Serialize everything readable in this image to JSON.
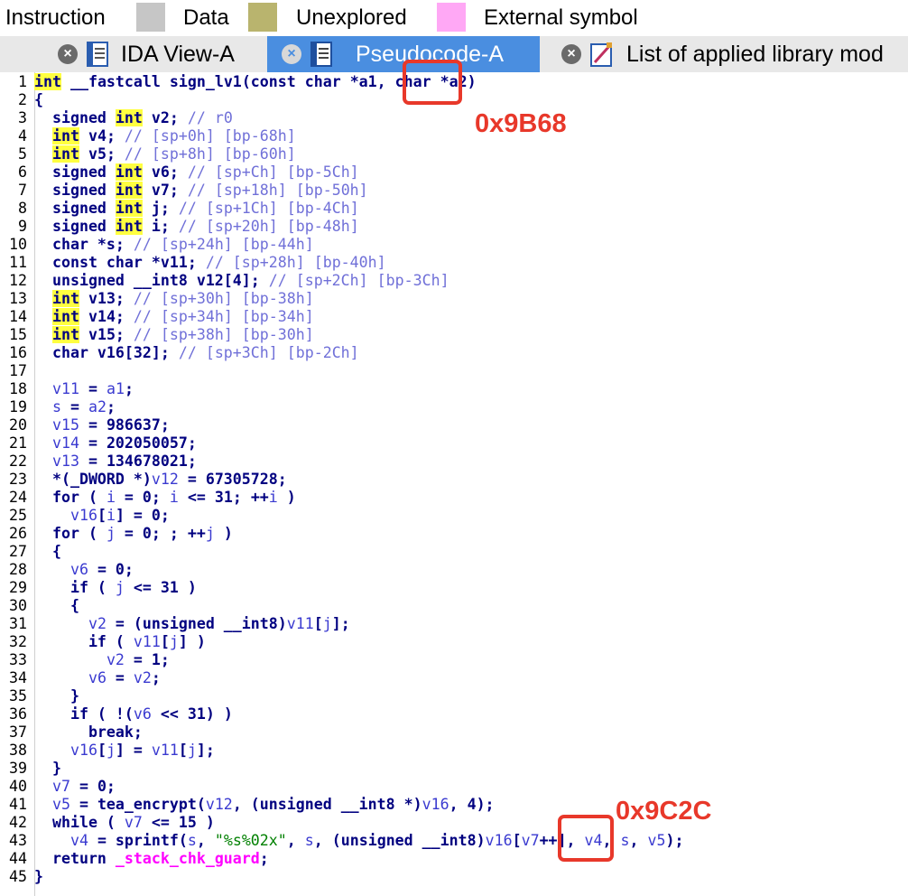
{
  "legend": {
    "items": [
      {
        "label": "Instruction",
        "color": "#c6c6c6"
      },
      {
        "label": "Data",
        "color": "#b9b46e"
      },
      {
        "label": "Unexplored",
        "color": "#ffa8f5"
      },
      {
        "label": "External symbol",
        "color": ""
      }
    ]
  },
  "tabs": [
    {
      "label": "IDA View-A",
      "icon": "document-icon",
      "active": false
    },
    {
      "label": "Pseudocode-A",
      "icon": "pseudocode-icon",
      "active": true
    },
    {
      "label": "List of applied library mod",
      "icon": "library-icon",
      "active": false
    }
  ],
  "annotations": [
    {
      "label": "0x9B68"
    },
    {
      "label": "0x9C2C"
    }
  ],
  "code": {
    "lines": [
      {
        "n": "1",
        "t": [
          [
            "kh",
            "int"
          ],
          [
            "p",
            " __fastcall "
          ],
          [
            "p",
            "sign_lv1"
          ],
          [
            "p",
            "(const char *a1, char *a2)"
          ]
        ]
      },
      {
        "n": "2",
        "t": [
          [
            "p",
            "{"
          ]
        ]
      },
      {
        "n": "3",
        "t": [
          [
            "p",
            "  signed "
          ],
          [
            "kh",
            "int"
          ],
          [
            "p",
            " v2; "
          ],
          [
            "c",
            "// r0"
          ]
        ]
      },
      {
        "n": "4",
        "t": [
          [
            "p",
            "  "
          ],
          [
            "kh",
            "int"
          ],
          [
            "p",
            " v4; "
          ],
          [
            "c",
            "// [sp+0h] [bp-68h]"
          ]
        ]
      },
      {
        "n": "5",
        "t": [
          [
            "p",
            "  "
          ],
          [
            "kh",
            "int"
          ],
          [
            "p",
            " v5; "
          ],
          [
            "c",
            "// [sp+8h] [bp-60h]"
          ]
        ]
      },
      {
        "n": "6",
        "t": [
          [
            "p",
            "  signed "
          ],
          [
            "kh",
            "int"
          ],
          [
            "p",
            " v6; "
          ],
          [
            "c",
            "// [sp+Ch] [bp-5Ch]"
          ]
        ]
      },
      {
        "n": "7",
        "t": [
          [
            "p",
            "  signed "
          ],
          [
            "kh",
            "int"
          ],
          [
            "p",
            " v7; "
          ],
          [
            "c",
            "// [sp+18h] [bp-50h]"
          ]
        ]
      },
      {
        "n": "8",
        "t": [
          [
            "p",
            "  signed "
          ],
          [
            "kh",
            "int"
          ],
          [
            "p",
            " j; "
          ],
          [
            "c",
            "// [sp+1Ch] [bp-4Ch]"
          ]
        ]
      },
      {
        "n": "9",
        "t": [
          [
            "p",
            "  signed "
          ],
          [
            "kh",
            "int"
          ],
          [
            "p",
            " i; "
          ],
          [
            "c",
            "// [sp+20h] [bp-48h]"
          ]
        ]
      },
      {
        "n": "10",
        "t": [
          [
            "p",
            "  char *s; "
          ],
          [
            "c",
            "// [sp+24h] [bp-44h]"
          ]
        ]
      },
      {
        "n": "11",
        "t": [
          [
            "p",
            "  const char *v11; "
          ],
          [
            "c",
            "// [sp+28h] [bp-40h]"
          ]
        ]
      },
      {
        "n": "12",
        "t": [
          [
            "p",
            "  unsigned __int8 v12[4]; "
          ],
          [
            "c",
            "// [sp+2Ch] [bp-3Ch]"
          ]
        ]
      },
      {
        "n": "13",
        "t": [
          [
            "p",
            "  "
          ],
          [
            "kh",
            "int"
          ],
          [
            "p",
            " v13; "
          ],
          [
            "c",
            "// [sp+30h] [bp-38h]"
          ]
        ]
      },
      {
        "n": "14",
        "t": [
          [
            "p",
            "  "
          ],
          [
            "kh",
            "int"
          ],
          [
            "p",
            " v14; "
          ],
          [
            "c",
            "// [sp+34h] [bp-34h]"
          ]
        ]
      },
      {
        "n": "15",
        "t": [
          [
            "p",
            "  "
          ],
          [
            "kh",
            "int"
          ],
          [
            "p",
            " v15; "
          ],
          [
            "c",
            "// [sp+38h] [bp-30h]"
          ]
        ]
      },
      {
        "n": "16",
        "t": [
          [
            "p",
            "  char v16[32]; "
          ],
          [
            "c",
            "// [sp+3Ch] [bp-2Ch]"
          ]
        ]
      },
      {
        "n": "17",
        "t": []
      },
      {
        "n": "18",
        "t": [
          [
            "p",
            "  "
          ],
          [
            "v",
            "v11"
          ],
          [
            "p",
            " = "
          ],
          [
            "v",
            "a1"
          ],
          [
            "p",
            ";"
          ]
        ]
      },
      {
        "n": "19",
        "t": [
          [
            "p",
            "  "
          ],
          [
            "v",
            "s"
          ],
          [
            "p",
            " = "
          ],
          [
            "v",
            "a2"
          ],
          [
            "p",
            ";"
          ]
        ]
      },
      {
        "n": "20",
        "t": [
          [
            "p",
            "  "
          ],
          [
            "v",
            "v15"
          ],
          [
            "p",
            " = 986637;"
          ]
        ]
      },
      {
        "n": "21",
        "t": [
          [
            "p",
            "  "
          ],
          [
            "v",
            "v14"
          ],
          [
            "p",
            " = 202050057;"
          ]
        ]
      },
      {
        "n": "22",
        "t": [
          [
            "p",
            "  "
          ],
          [
            "v",
            "v13"
          ],
          [
            "p",
            " = 134678021;"
          ]
        ]
      },
      {
        "n": "23",
        "t": [
          [
            "p",
            "  *(_DWORD *)"
          ],
          [
            "v",
            "v12"
          ],
          [
            "p",
            " = 67305728;"
          ]
        ]
      },
      {
        "n": "24",
        "t": [
          [
            "p",
            "  for ( "
          ],
          [
            "v",
            "i"
          ],
          [
            "p",
            " = 0; "
          ],
          [
            "v",
            "i"
          ],
          [
            "p",
            " <= 31; ++"
          ],
          [
            "v",
            "i"
          ],
          [
            "p",
            " )"
          ]
        ]
      },
      {
        "n": "25",
        "t": [
          [
            "p",
            "    "
          ],
          [
            "v",
            "v16"
          ],
          [
            "p",
            "["
          ],
          [
            "v",
            "i"
          ],
          [
            "p",
            "] = 0;"
          ]
        ]
      },
      {
        "n": "26",
        "t": [
          [
            "p",
            "  for ( "
          ],
          [
            "v",
            "j"
          ],
          [
            "p",
            " = 0; ; ++"
          ],
          [
            "v",
            "j"
          ],
          [
            "p",
            " )"
          ]
        ]
      },
      {
        "n": "27",
        "t": [
          [
            "p",
            "  {"
          ]
        ]
      },
      {
        "n": "28",
        "t": [
          [
            "p",
            "    "
          ],
          [
            "v",
            "v6"
          ],
          [
            "p",
            " = 0;"
          ]
        ]
      },
      {
        "n": "29",
        "t": [
          [
            "p",
            "    if ( "
          ],
          [
            "v",
            "j"
          ],
          [
            "p",
            " <= 31 )"
          ]
        ]
      },
      {
        "n": "30",
        "t": [
          [
            "p",
            "    {"
          ]
        ]
      },
      {
        "n": "31",
        "t": [
          [
            "p",
            "      "
          ],
          [
            "v",
            "v2"
          ],
          [
            "p",
            " = (unsigned __int8)"
          ],
          [
            "v",
            "v11"
          ],
          [
            "p",
            "["
          ],
          [
            "v",
            "j"
          ],
          [
            "p",
            "];"
          ]
        ]
      },
      {
        "n": "32",
        "t": [
          [
            "p",
            "      if ( "
          ],
          [
            "v",
            "v11"
          ],
          [
            "p",
            "["
          ],
          [
            "v",
            "j"
          ],
          [
            "p",
            "] )"
          ]
        ]
      },
      {
        "n": "33",
        "t": [
          [
            "p",
            "        "
          ],
          [
            "v",
            "v2"
          ],
          [
            "p",
            " = 1;"
          ]
        ]
      },
      {
        "n": "34",
        "t": [
          [
            "p",
            "      "
          ],
          [
            "v",
            "v6"
          ],
          [
            "p",
            " = "
          ],
          [
            "v",
            "v2"
          ],
          [
            "p",
            ";"
          ]
        ]
      },
      {
        "n": "35",
        "t": [
          [
            "p",
            "    }"
          ]
        ]
      },
      {
        "n": "36",
        "t": [
          [
            "p",
            "    if ( !("
          ],
          [
            "v",
            "v6"
          ],
          [
            "p",
            " << 31) )"
          ]
        ]
      },
      {
        "n": "37",
        "t": [
          [
            "p",
            "      break;"
          ]
        ]
      },
      {
        "n": "38",
        "t": [
          [
            "p",
            "    "
          ],
          [
            "v",
            "v16"
          ],
          [
            "p",
            "["
          ],
          [
            "v",
            "j"
          ],
          [
            "p",
            "] = "
          ],
          [
            "v",
            "v11"
          ],
          [
            "p",
            "["
          ],
          [
            "v",
            "j"
          ],
          [
            "p",
            "];"
          ]
        ]
      },
      {
        "n": "39",
        "t": [
          [
            "p",
            "  }"
          ]
        ]
      },
      {
        "n": "40",
        "t": [
          [
            "p",
            "  "
          ],
          [
            "v",
            "v7"
          ],
          [
            "p",
            " = 0;"
          ]
        ]
      },
      {
        "n": "41",
        "t": [
          [
            "p",
            "  "
          ],
          [
            "v",
            "v5"
          ],
          [
            "p",
            " = tea_encrypt("
          ],
          [
            "v",
            "v12"
          ],
          [
            "p",
            ", (unsigned __int8 *)"
          ],
          [
            "v",
            "v16"
          ],
          [
            "p",
            ", 4);"
          ]
        ]
      },
      {
        "n": "42",
        "t": [
          [
            "p",
            "  while ( "
          ],
          [
            "v",
            "v7"
          ],
          [
            "p",
            " <= 15 )"
          ]
        ]
      },
      {
        "n": "43",
        "t": [
          [
            "p",
            "    "
          ],
          [
            "v",
            "v4"
          ],
          [
            "p",
            " = sprintf("
          ],
          [
            "v",
            "s"
          ],
          [
            "p",
            ", "
          ],
          [
            "s",
            "\"%s%02x\""
          ],
          [
            "p",
            ", "
          ],
          [
            "v",
            "s"
          ],
          [
            "p",
            ", (unsigned __int8)"
          ],
          [
            "v",
            "v16"
          ],
          [
            "p",
            "["
          ],
          [
            "v",
            "v7"
          ],
          [
            "p",
            "++], "
          ],
          [
            "v",
            "v4"
          ],
          [
            "p",
            ", "
          ],
          [
            "v",
            "s"
          ],
          [
            "p",
            ", "
          ],
          [
            "v",
            "v5"
          ],
          [
            "p",
            ");"
          ]
        ]
      },
      {
        "n": "44",
        "t": [
          [
            "p",
            "  return "
          ],
          [
            "pk",
            "_stack_chk_guard"
          ],
          [
            "p",
            ";"
          ]
        ]
      },
      {
        "n": "45",
        "t": [
          [
            "p",
            "}"
          ]
        ]
      }
    ]
  }
}
